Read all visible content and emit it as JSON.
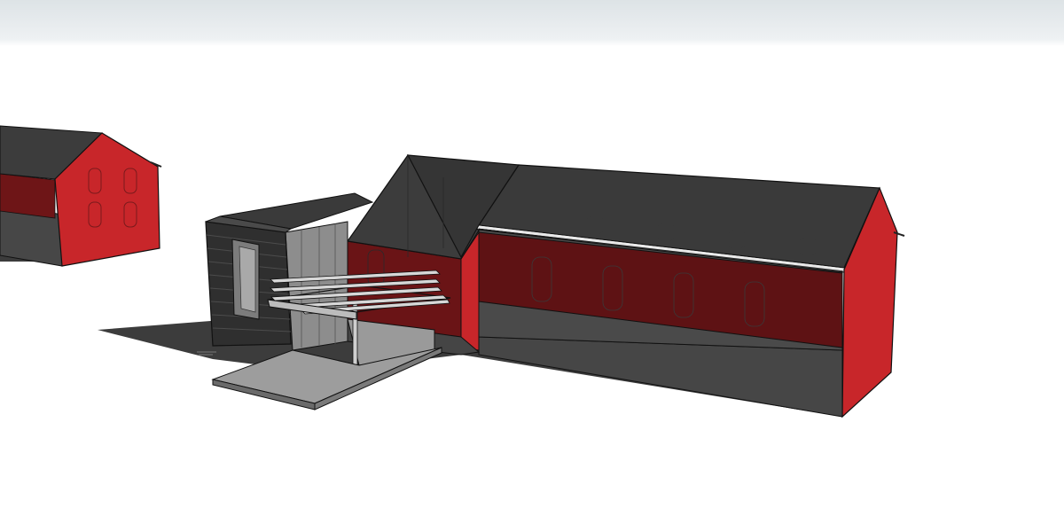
{
  "viewport": {
    "view": "perspective",
    "colors": {
      "sky": "#e3e8eb",
      "ground": "#ffffff",
      "roof": "#3b3b3b",
      "wall_red": "#c8262a",
      "wall_red_shadowed": "#6a1416",
      "wall_grey": "#454545",
      "shadow": "#3e3e3e",
      "edges": "#111111",
      "cladding": "#2e2e2e",
      "glass": "#8a8a8a",
      "pergola": "#bdbdbd",
      "terrace": "#9a9a9a"
    },
    "objects": [
      {
        "name": "neighbouring-house",
        "material": "red-walls-grey-roof"
      },
      {
        "name": "main-barn",
        "material": "red-walls-grey-roof"
      },
      {
        "name": "cross-gable-wing",
        "material": "red-walls-grey-roof"
      },
      {
        "name": "clad-extension",
        "material": "dark-cladding"
      },
      {
        "name": "glazed-link",
        "material": "glass"
      },
      {
        "name": "pergola",
        "material": "light-grey"
      },
      {
        "name": "terrace-slab",
        "material": "concrete"
      }
    ]
  }
}
